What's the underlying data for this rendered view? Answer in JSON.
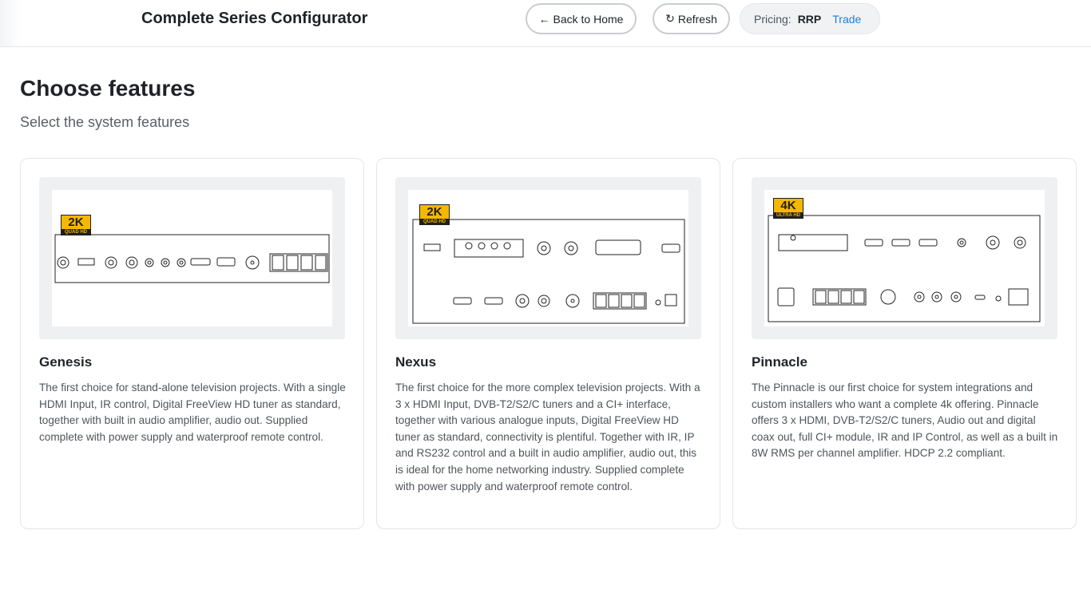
{
  "header": {
    "title": "Complete Series Configurator",
    "back_label": "Back to Home",
    "back_icon": "←",
    "refresh_label": "Refresh",
    "refresh_icon": "↻",
    "pricing_label": "Pricing:",
    "pricing_options": [
      "RRP",
      "Trade"
    ],
    "pricing_selected": "RRP"
  },
  "page": {
    "title": "Choose features",
    "subtitle": "Select the system features"
  },
  "cards": [
    {
      "name": "Genesis",
      "badge": "2K",
      "badge_sub": "QUAD HD",
      "description": "The first choice for stand-alone television projects. With a single HDMI Input, IR control, Digital FreeView HD tuner as standard, together with built in audio amplifier, audio out. Supplied complete with power supply and waterproof remote control."
    },
    {
      "name": "Nexus",
      "badge": "2K",
      "badge_sub": "QUAD HD",
      "description": "The first choice for the more complex television projects. With a 3 x HDMI Input, DVB-T2/S2/C tuners and a CI+ interface, together with various analogue inputs, Digital FreeView HD tuner as standard, connectivity is plentiful. Together with IR, IP and RS232 control and a built in audio amplifier, audio out, this is ideal for the home networking industry. Supplied complete with power supply and waterproof remote control."
    },
    {
      "name": "Pinnacle",
      "badge": "4K",
      "badge_sub": "ULTRA HD",
      "description": "The Pinnacle is our first choice for system integrations and custom installers who want a complete 4k offering. Pinnacle offers 3 x HDMI, DVB-T2/S2/C tuners, Audio out and digital coax out, full CI+ module, IR and IP Control, as well as a built in 8W RMS per channel amplifier. HDCP 2.2 compliant."
    }
  ],
  "colors": {
    "accent": "#1d7fd8",
    "badge_gold": "#f5b800"
  }
}
